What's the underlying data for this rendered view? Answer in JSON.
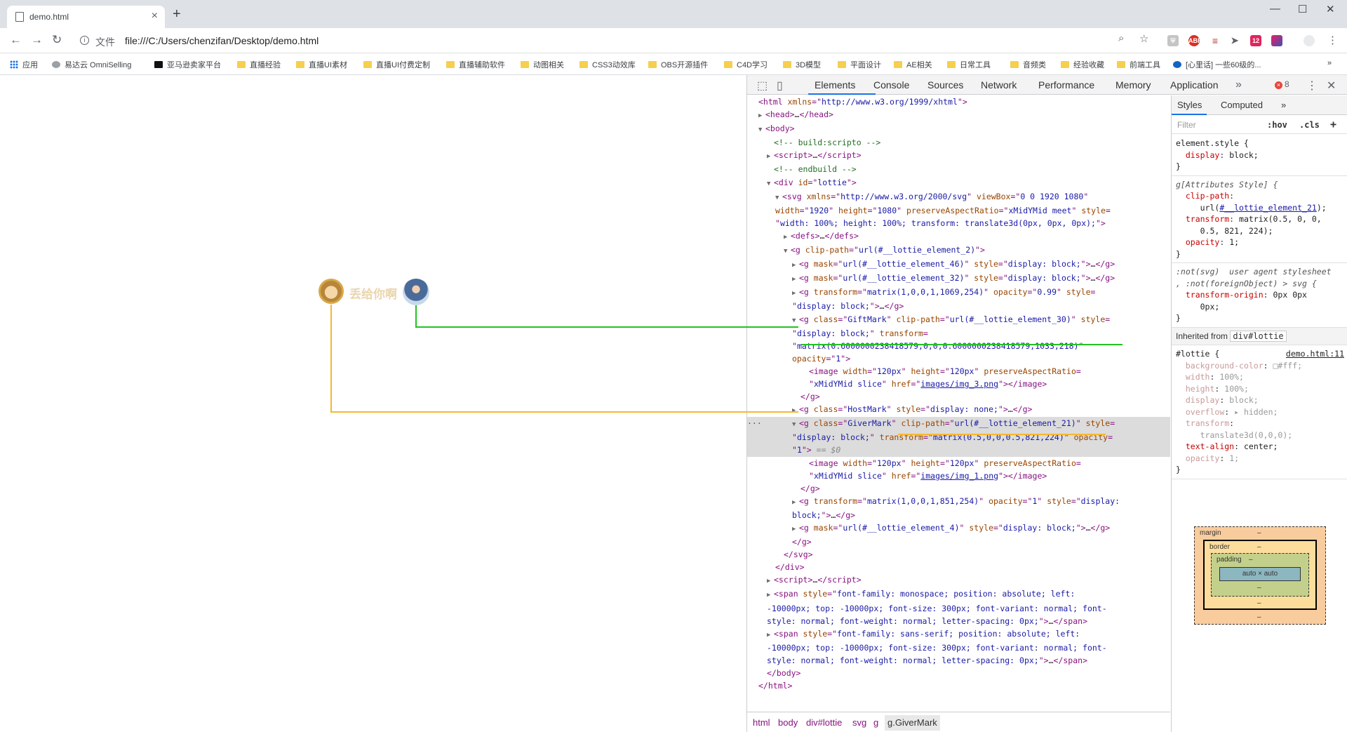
{
  "browser": {
    "tab_title": "demo.html",
    "address_scheme_label": "文件",
    "url": "file:///C:/Users/chenzifan/Desktop/demo.html",
    "error_count": "8",
    "ext_badge": "12"
  },
  "bookmarks": [
    "应用",
    "易达云 OmniSelling",
    "亚马逊卖家平台",
    "直播经验",
    "直播UI素材",
    "直播UI付费定制",
    "直播辅助软件",
    "动图相关",
    "CSS3动效库",
    "OBS开源插件",
    "C4D学习",
    "3D模型",
    "平面设计",
    "AE相关",
    "日常工具",
    "音频类",
    "经验收藏",
    "前端工具",
    "[心里话] 一些60级的..."
  ],
  "page": {
    "gift_text": "丢给你啊"
  },
  "devtools": {
    "tabs": [
      "Elements",
      "Console",
      "Sources",
      "Network",
      "Performance",
      "Memory",
      "Application"
    ],
    "breadcrumbs": [
      "html",
      "body",
      "div#lottie",
      "svg",
      "g",
      "g.GiverMark"
    ],
    "styles_tabs": [
      "Styles",
      "Computed"
    ],
    "filter_placeholder": "Filter",
    "hov": ":hov",
    "cls": ".cls",
    "inherited_from_label": "Inherited from",
    "inherited_from_node": "div#lottie",
    "lottie_source": "demo.html:11",
    "box_model": {
      "margin": "margin",
      "border": "border",
      "padding": "padding",
      "content": "auto × auto",
      "dash": "–"
    }
  },
  "highlight_colors": {
    "gift_line": "#22c322",
    "giver_line": "#f5b830"
  }
}
